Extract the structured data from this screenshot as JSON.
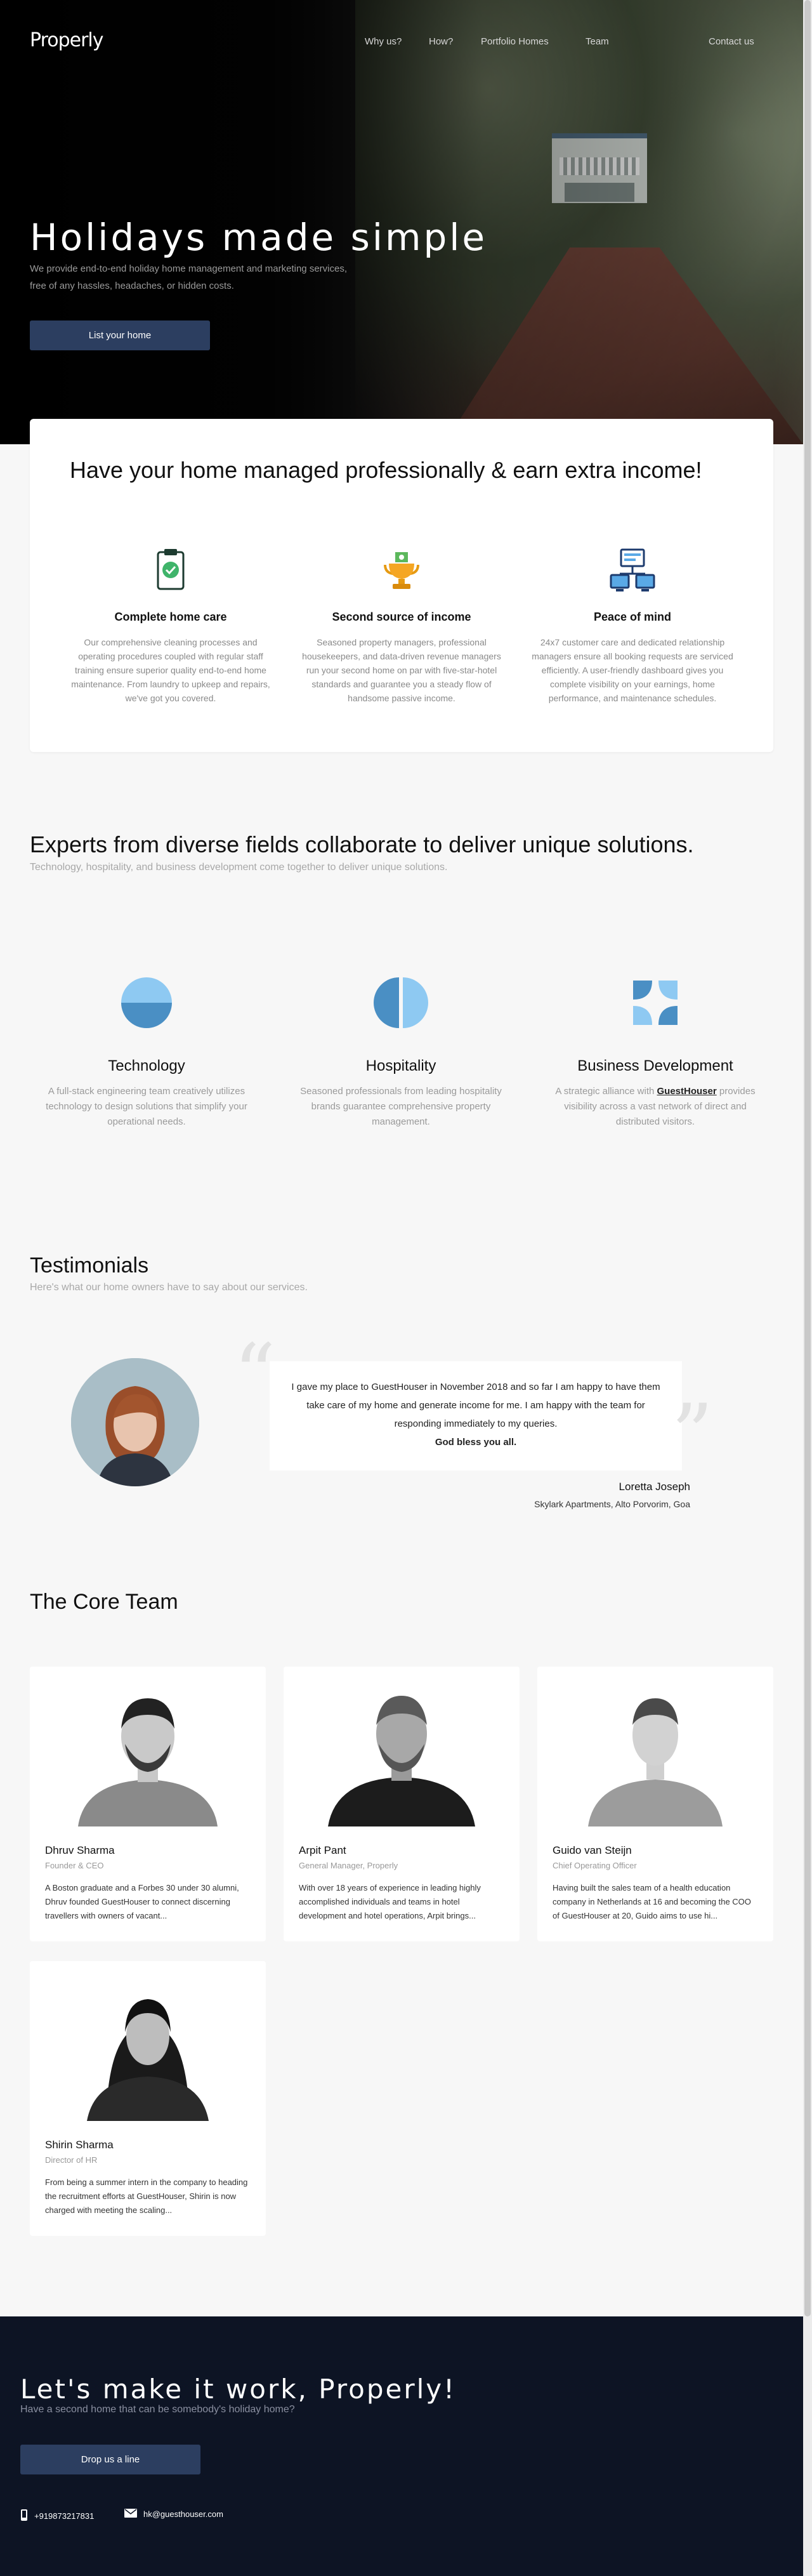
{
  "brand": {
    "logo": "Properly"
  },
  "nav": {
    "items": [
      "Why us?",
      "How?",
      "Portfolio Homes",
      "Team",
      "Contact us"
    ]
  },
  "hero": {
    "title": "Holidays made simple",
    "subtitle": "We provide end-to-end holiday home management and marketing services, free of any hassles, headaches, or hidden costs.",
    "cta": "List your home"
  },
  "benefits": {
    "title": "Have your home managed professionally & earn extra income!",
    "items": [
      {
        "icon": "clipboard-check-icon",
        "title": "Complete home care",
        "text": "Our comprehensive cleaning processes and operating procedures coupled with regular staff training ensure superior quality end-to-end home maintenance. From laundry to upkeep and repairs, we've got you covered."
      },
      {
        "icon": "trophy-money-icon",
        "title": "Second source of income",
        "text": "Seasoned property managers, professional housekeepers, and data-driven revenue managers run your second home on par with five-star-hotel standards and guarantee you a steady flow of handsome passive income."
      },
      {
        "icon": "dashboard-computers-icon",
        "title": "Peace of mind",
        "text": "24x7 customer care and dedicated relationship managers ensure all booking requests are serviced efficiently. A user-friendly dashboard gives you complete visibility on your earnings, home performance, and maintenance schedules."
      }
    ]
  },
  "experts": {
    "title": "Experts from diverse fields collaborate to deliver unique solutions.",
    "subtitle": "Technology, hospitality, and business development come together to deliver unique solutions.",
    "items": [
      {
        "icon": "half-circle-icon",
        "title": "Technology",
        "text": "A full-stack engineering team creatively utilizes technology to design solutions that simplify your operational needs."
      },
      {
        "icon": "split-circle-icon",
        "title": "Hospitality",
        "text": "Seasoned professionals from leading hospitality brands guarantee comprehensive property management."
      },
      {
        "icon": "four-petal-icon",
        "title": "Business Development",
        "text_before": "A strategic alliance with ",
        "link": "GuestHouser",
        "text_after": " provides visibility across a vast network of direct and distributed visitors."
      }
    ]
  },
  "testimonials": {
    "title": "Testimonials",
    "subtitle": "Here's what our home owners have to say about our services.",
    "quote": "I gave my place to GuestHouser in November 2018 and so far I am happy to have them take care of my home and generate income for me. I am happy with the team for responding immediately to my queries.",
    "quote_bold": "God bless you all.",
    "name": "Loretta Joseph",
    "place": "Skylark Apartments, Alto Porvorim, Goa"
  },
  "team": {
    "title": "The Core Team",
    "members": [
      {
        "name": "Dhruv Sharma",
        "role": "Founder & CEO",
        "bio": "A Boston graduate and a Forbes 30 under 30 alumni, Dhruv founded GuestHouser to connect discerning travellers with owners of vacant..."
      },
      {
        "name": "Arpit Pant",
        "role": "General Manager, Properly",
        "bio": "With over 18 years of experience in leading highly accomplished individuals and teams in hotel development and hotel operations, Arpit brings..."
      },
      {
        "name": "Guido van Steijn",
        "role": "Chief Operating Officer",
        "bio": "Having built the sales team of a health education company in Netherlands at 16 and becoming the COO of GuestHouser at 20, Guido aims to use hi..."
      },
      {
        "name": "Shirin Sharma",
        "role": "Director of HR",
        "bio": "From being a summer intern in the company to heading the recruitment efforts at GuestHouser, Shirin is now charged with meeting the scaling..."
      }
    ]
  },
  "footer": {
    "title": "Let's make it work, Properly!",
    "subtitle": "Have a second home that can be somebody's holiday home?",
    "cta": "Drop us a line",
    "phone": "+919873217831",
    "email": "hk@guesthouser.com"
  }
}
